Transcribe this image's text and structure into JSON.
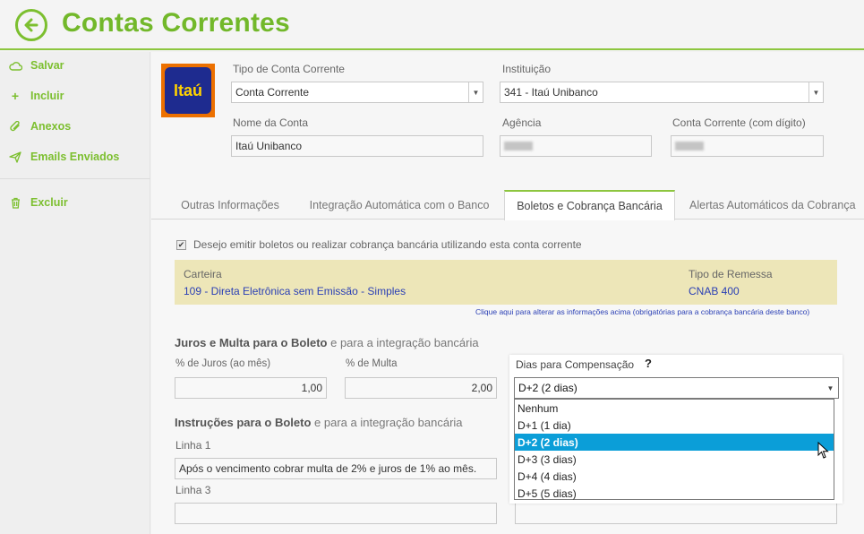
{
  "header": {
    "title": "Contas Correntes",
    "back_icon": "arrow-left-circle-icon"
  },
  "sidebar": {
    "items": [
      {
        "label": "Salvar",
        "icon": "cloud-icon"
      },
      {
        "label": "Incluir",
        "icon": "plus-icon"
      },
      {
        "label": "Anexos",
        "icon": "paperclip-icon"
      },
      {
        "label": "Emails Enviados",
        "icon": "send-icon"
      },
      {
        "label": "Excluir",
        "icon": "trash-icon"
      }
    ]
  },
  "logo": {
    "text": "Itaú"
  },
  "form": {
    "tipo_label": "Tipo de Conta Corrente",
    "tipo_value": "Conta Corrente",
    "instituicao_label": "Instituição",
    "instituicao_value": "341 - Itaú Unibanco",
    "nome_label": "Nome da Conta",
    "nome_value": "Itaú Unibanco",
    "agencia_label": "Agência",
    "conta_label": "Conta Corrente (com dígito)"
  },
  "tabs": [
    {
      "label": "Outras Informações"
    },
    {
      "label": "Integração Automática com o Banco"
    },
    {
      "label": "Boletos e Cobrança Bancária"
    },
    {
      "label": "Alertas Automáticos da Cobrança"
    }
  ],
  "boletos": {
    "checkbox_label": "Desejo emitir boletos ou realizar cobrança bancária utilizando esta conta corrente",
    "carteira_label": "Carteira",
    "carteira_value": "109 - Direta Eletrônica sem Emissão - Simples",
    "remessa_label": "Tipo de Remessa",
    "remessa_value": "CNAB 400",
    "alter_link": "Clique aqui para alterar as informações acima (obrigatórias para a cobrança bancária deste banco)",
    "juros_title_bold": "Juros e Multa para o Boleto",
    "juros_title_rest": " e para a integração bancária",
    "juros_label": "% de Juros (ao mês)",
    "juros_value": "1,00",
    "multa_label": "% de Multa",
    "multa_value": "2,00",
    "instr_title_bold": "Instruções para o Boleto",
    "instr_title_rest": " e para a integração bancária",
    "linha1_label": "Linha 1",
    "linha1_value": "Após o vencimento cobrar multa de 2% e juros de 1% ao mês.",
    "linha3_label": "Linha 3"
  },
  "dias": {
    "label": "Dias para Compensação",
    "help": "?",
    "selected": "D+2 (2 dias)",
    "options": [
      "Nenhum",
      "D+1 (1 dia)",
      "D+2 (2 dias)",
      "D+3 (3 dias)",
      "D+4 (4 dias)",
      "D+5 (5 dias)"
    ],
    "highlighted_index": 2
  },
  "colors": {
    "accent": "#7cbf2f",
    "highlight": "#0b9ed8",
    "link": "#2a3fb5"
  }
}
